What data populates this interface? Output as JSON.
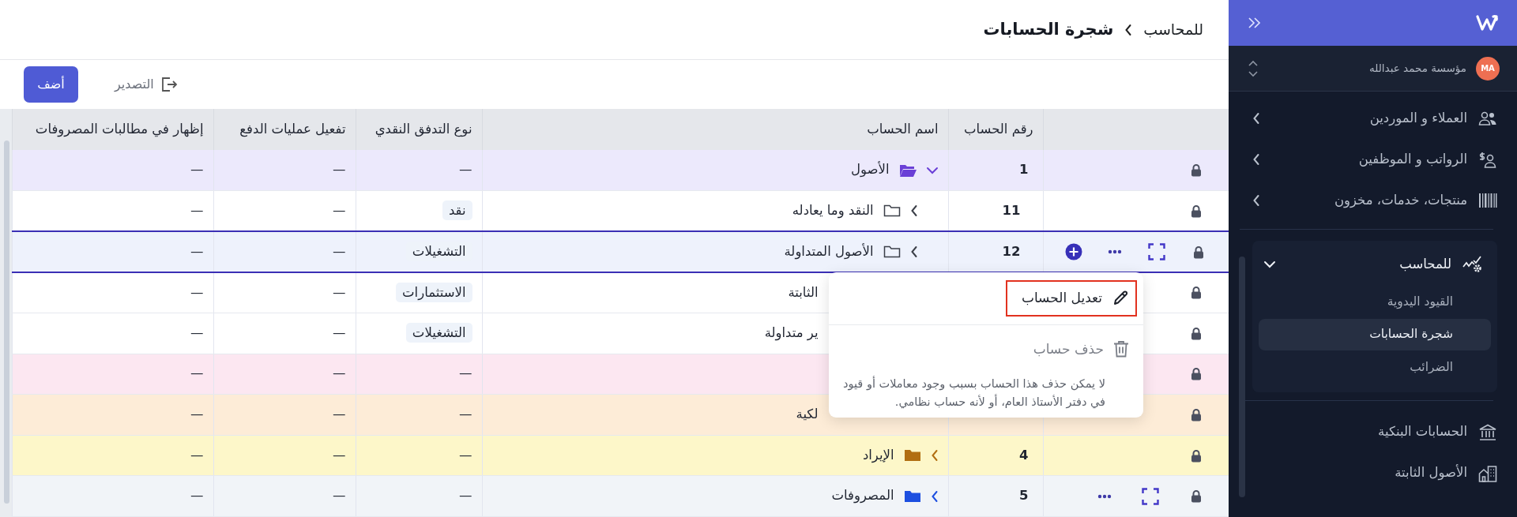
{
  "sidebar": {
    "org": {
      "initials": "MA",
      "name": "مؤسسة محمد عبدالله"
    },
    "top_items": [
      {
        "label": "العملاء و الموردين",
        "expanded": false
      },
      {
        "label": "الرواتب و الموظفين",
        "expanded": false
      },
      {
        "label": "منتجات، خدمات، مخزون",
        "expanded": false
      }
    ],
    "group": {
      "label": "للمحاسب",
      "expanded": true,
      "children": [
        {
          "label": "القيود اليدوية",
          "selected": false
        },
        {
          "label": "شجرة الحسابات",
          "selected": true
        },
        {
          "label": "الضرائب",
          "selected": false
        }
      ]
    },
    "bottom_items": [
      {
        "label": "الحسابات البنكية"
      },
      {
        "label": "الأصول الثابتة"
      }
    ]
  },
  "breadcrumb": [
    {
      "label": "للمحاسب",
      "current": false
    },
    {
      "label": "شجرة الحسابات",
      "current": true
    }
  ],
  "toolbar": {
    "export_label": "التصدير",
    "add_label": "أضف"
  },
  "table": {
    "columns": [
      "رقم الحساب",
      "اسم الحساب",
      "نوع التدفق النقدي",
      "تفعيل عمليات الدفع",
      "إظهار في مطالبات المصروفات"
    ],
    "rows": [
      {
        "kind": "root",
        "number": "1",
        "name": "الأصول",
        "expanded": true,
        "selected": false,
        "actions": false,
        "color": "#ece9fc",
        "folder": {
          "color": "#6a3fd6"
        },
        "cash_flow": "—",
        "tagged": false,
        "payments": "—",
        "expense_claims": "—"
      },
      {
        "kind": "child",
        "number": "11",
        "name": "النقد وما يعادله",
        "expanded": false,
        "selected": false,
        "actions": false,
        "cash_flow": "نقد",
        "tagged": true,
        "payments": "—",
        "expense_claims": "—"
      },
      {
        "kind": "child",
        "number": "12",
        "name": "الأصول المتداولة",
        "expanded": false,
        "selected": true,
        "actions": true,
        "cash_flow": "التشغيلات",
        "tagged": true,
        "payments": "—",
        "expense_claims": "—"
      },
      {
        "kind": "covered",
        "name": "الثابتة",
        "selected": false,
        "actions": false,
        "cash_flow": "الاستثمارات",
        "tagged": true,
        "payments": "—",
        "expense_claims": "—"
      },
      {
        "kind": "covered",
        "name": "ير متداولة",
        "selected": false,
        "actions": false,
        "cash_flow": "التشغيلات",
        "tagged": true,
        "payments": "—",
        "expense_claims": "—"
      },
      {
        "kind": "covered",
        "selected": false,
        "actions": false,
        "color": "#fce7f1",
        "cash_flow": "—",
        "tagged": false,
        "payments": "—",
        "expense_claims": "—"
      },
      {
        "kind": "covered",
        "name": "لكية",
        "selected": false,
        "actions": false,
        "color": "#fdecd7",
        "cash_flow": "—",
        "tagged": false,
        "payments": "—",
        "expense_claims": "—"
      },
      {
        "kind": "root",
        "number": "4",
        "name": "الإيراد",
        "expanded": false,
        "selected": false,
        "actions": false,
        "color": "#fdf7c9",
        "folder": {
          "color": "#b16e12"
        },
        "cash_flow": "—",
        "tagged": false,
        "payments": "—",
        "expense_claims": "—"
      },
      {
        "kind": "root",
        "number": "5",
        "name": "المصروفات",
        "expanded": false,
        "selected": false,
        "actions": true,
        "color": "#f1f4f8",
        "folder": {
          "color": "#1d4fe0"
        },
        "cash_flow": "—",
        "tagged": false,
        "payments": "—",
        "expense_claims": "—"
      }
    ]
  },
  "context_menu": {
    "items": [
      {
        "label": "تعديل الحساب",
        "kind": "edit",
        "highlighted": true,
        "disabled": false
      },
      {
        "label": "حذف حساب",
        "kind": "delete",
        "highlighted": false,
        "disabled": true
      }
    ],
    "note": {
      "before": "لا يمكن حذف هذا الحساب بسبب وجود معاملات أو قيود في",
      "link": "دفتر الأستاذ العام",
      "after": "، أو لأنه حساب نظامي."
    }
  }
}
